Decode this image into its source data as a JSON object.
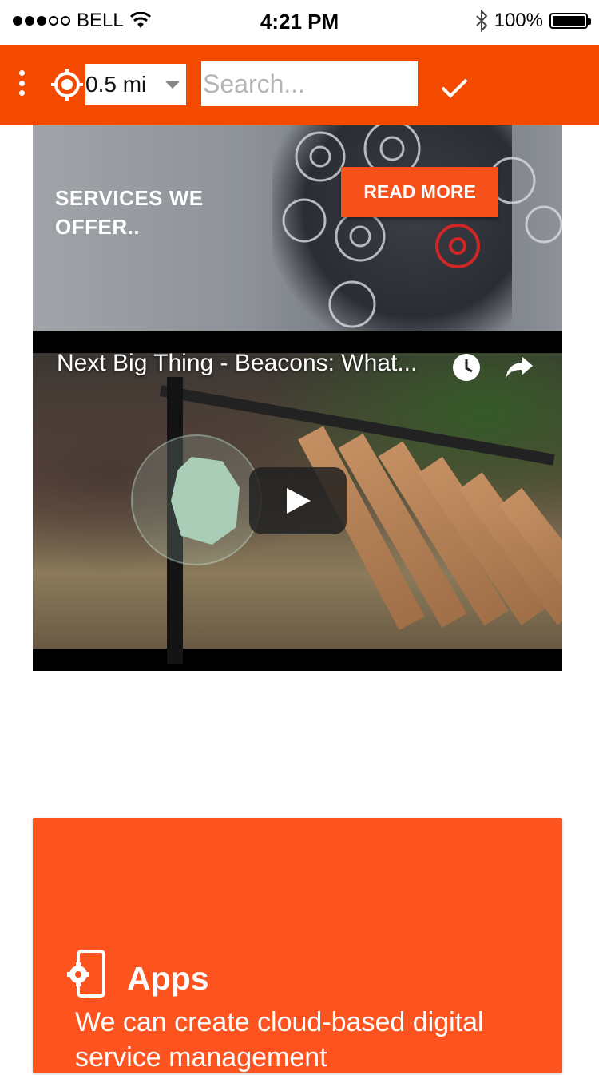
{
  "status_bar": {
    "carrier": "BELL",
    "time": "4:21 PM",
    "battery": "100%",
    "signal_bars_filled": 3,
    "signal_bars_total": 5,
    "battery_level": 1.0
  },
  "toolbar": {
    "menu_icon": "more-vert-icon",
    "location_icon": "gps-target-icon",
    "distance_value": "0.5 mi",
    "search_placeholder": "Search...",
    "confirm_icon": "check-icon",
    "color": "#f44a00"
  },
  "banner": {
    "heading": "SERVICES WE\nOFFER..",
    "button_label": "READ MORE",
    "button_color": "#f6501b"
  },
  "video": {
    "title": "Next Big Thing - Beacons: What...",
    "watch_later_icon": "clock-icon",
    "share_icon": "share-icon",
    "play_icon": "play-icon"
  },
  "apps_card": {
    "icon": "phone-settings-icon",
    "title": "Apps",
    "description": "We can create cloud-based digital service management",
    "color": "#fd541f"
  }
}
